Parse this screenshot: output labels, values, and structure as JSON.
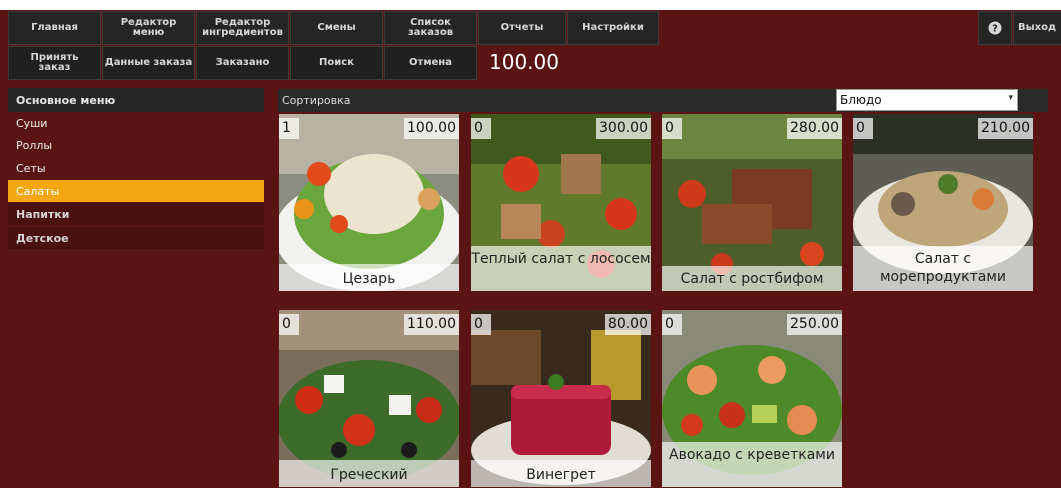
{
  "nav_row1": [
    {
      "label": "Главная"
    },
    {
      "label": "Редактор\nменю"
    },
    {
      "label": "Редактор\nингредиентов"
    },
    {
      "label": "Смены"
    },
    {
      "label": "Список\nзаказов"
    },
    {
      "label": "Отчеты"
    },
    {
      "label": "Настройки"
    }
  ],
  "nav_row2": [
    {
      "label": "Принять\nзаказ"
    },
    {
      "label": "Данные заказа"
    },
    {
      "label": "Заказано"
    },
    {
      "label": "Поиск"
    },
    {
      "label": "Отмена"
    }
  ],
  "help_icon": "question-circle-icon",
  "exit_label": "Выход",
  "order_total": "100.00",
  "menu": {
    "header": "Основное меню",
    "categories": [
      {
        "label": "Суши"
      },
      {
        "label": "Роллы"
      },
      {
        "label": "Сеты"
      },
      {
        "label": "Салаты"
      },
      {
        "label": "Напитки"
      },
      {
        "label": "Детское"
      }
    ]
  },
  "sort": {
    "label": "Сортировка",
    "selected": "Блюдо"
  },
  "dishes": [
    {
      "qty": "1",
      "price": "100.00",
      "name": "Цезарь"
    },
    {
      "qty": "0",
      "price": "300.00",
      "name": "Теплый салат с лососем"
    },
    {
      "qty": "0",
      "price": "280.00",
      "name": "Салат с ростбифом"
    },
    {
      "qty": "0",
      "price": "210.00",
      "name": "Салат с морепродуктами"
    },
    {
      "qty": "0",
      "price": "110.00",
      "name": "Греческий"
    },
    {
      "qty": "0",
      "price": "80.00",
      "name": "Винегрет"
    },
    {
      "qty": "0",
      "price": "250.00",
      "name": "Авокадо с креветками"
    }
  ],
  "colors": {
    "background": "#5b1414",
    "active_category": "#f5a712",
    "toolbar_button": "#252525"
  }
}
